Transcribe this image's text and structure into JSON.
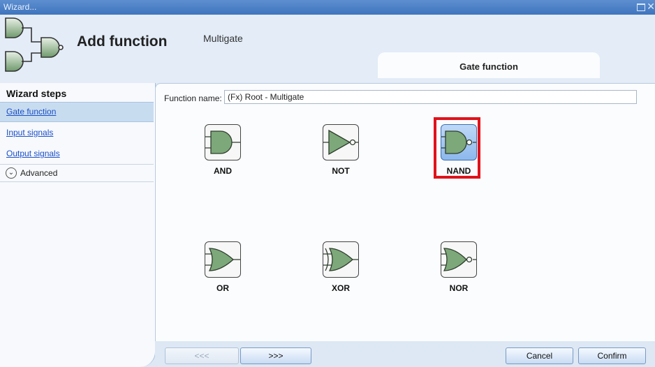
{
  "window": {
    "title": "Wizard..."
  },
  "header": {
    "title": "Add function",
    "subtitle": "Multigate",
    "tab_label": "Gate function",
    "logo_icon": "multigate-logo-icon"
  },
  "sidebar": {
    "heading": "Wizard steps",
    "steps": [
      {
        "label": "Gate function",
        "selected": true
      },
      {
        "label": "Input signals",
        "selected": false
      },
      {
        "label": "Output signals",
        "selected": false
      }
    ],
    "advanced_label": "Advanced"
  },
  "content": {
    "function_name_label": "Function name:",
    "function_name_value": "(Fx) Root - Multigate",
    "gates": [
      {
        "label": "AND",
        "icon": "and-gate-icon",
        "selected": false
      },
      {
        "label": "NOT",
        "icon": "not-gate-icon",
        "selected": false
      },
      {
        "label": "NAND",
        "icon": "nand-gate-icon",
        "selected": true
      },
      {
        "label": "OR",
        "icon": "or-gate-icon",
        "selected": false
      },
      {
        "label": "XOR",
        "icon": "xor-gate-icon",
        "selected": false
      },
      {
        "label": "NOR",
        "icon": "nor-gate-icon",
        "selected": false
      }
    ],
    "highlight_color": "#e0121a"
  },
  "footer": {
    "prev_label": "<<<",
    "next_label": ">>>",
    "cancel_label": "Cancel",
    "confirm_label": "Confirm"
  }
}
